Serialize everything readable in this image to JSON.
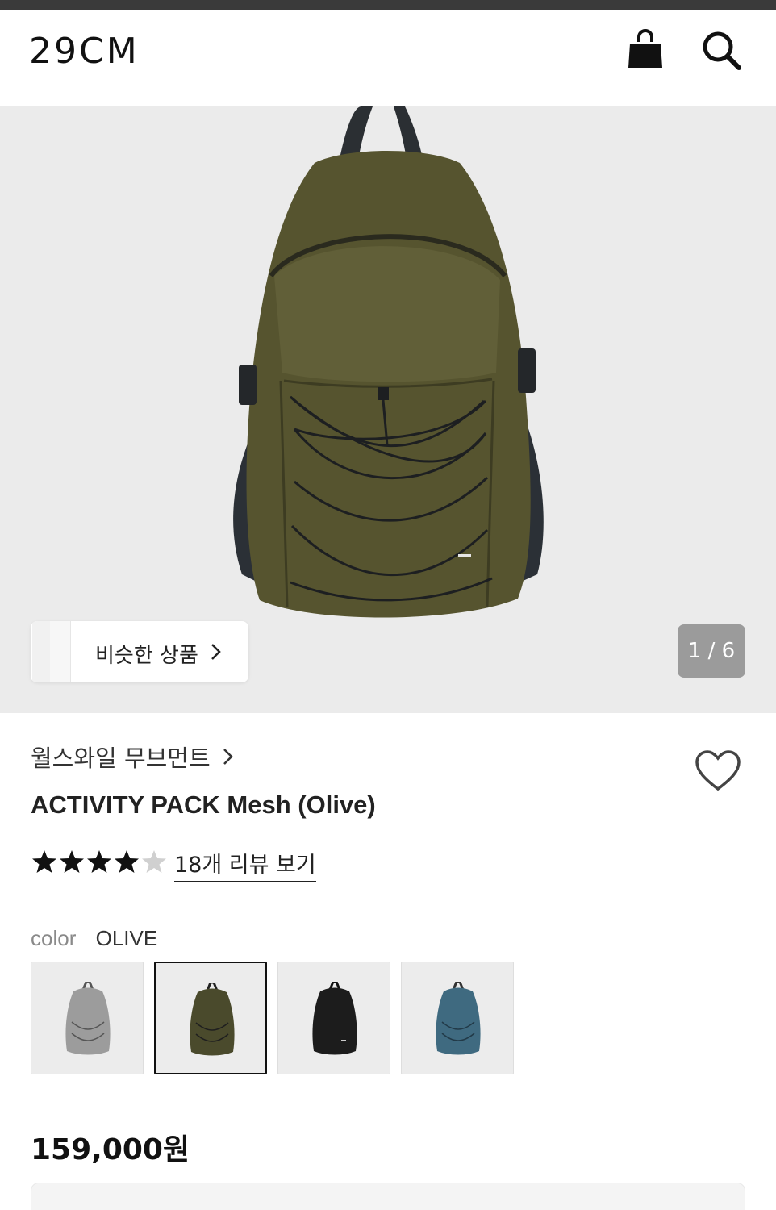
{
  "header": {
    "logo": "29CM",
    "cart_icon": "shopping-bag-icon",
    "search_icon": "search-icon"
  },
  "gallery": {
    "similar_label": "비슷한 상품",
    "counter": "1 / 6"
  },
  "product": {
    "brand": "월스와일 무브먼트",
    "title": "ACTIVITY PACK Mesh (Olive)",
    "rating": 4.5,
    "rating_max": 5,
    "review_link": "18개 리뷰 보기",
    "color_label": "color",
    "color_value": "OLIVE",
    "price": "159,000원"
  },
  "color_options": [
    {
      "name": "grey",
      "color": "#9c9c9c",
      "selected": false
    },
    {
      "name": "olive",
      "color": "#4a4a2c",
      "selected": true
    },
    {
      "name": "black",
      "color": "#1c1c1c",
      "selected": false
    },
    {
      "name": "blue",
      "color": "#3f6a80",
      "selected": false
    }
  ],
  "colors": {
    "bag_olive": "#56542f",
    "counter_bg": "#9b9b9b",
    "hero_bg": "#ebebeb"
  }
}
